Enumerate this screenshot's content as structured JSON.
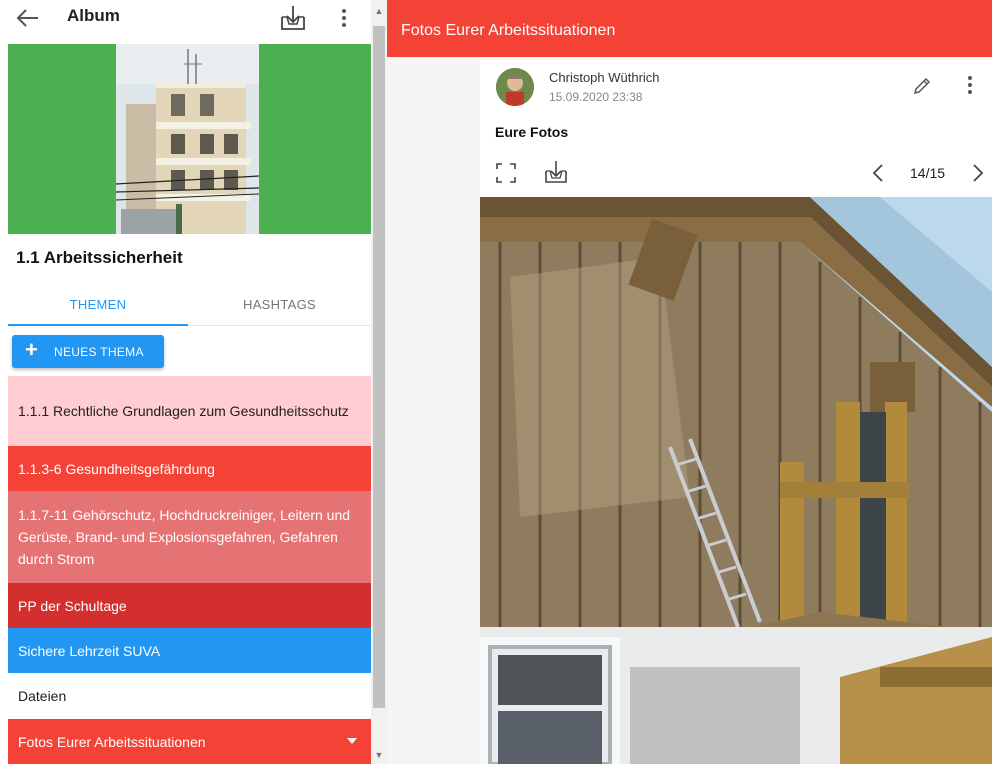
{
  "left": {
    "title": "Album",
    "section_title": "1.1 Arbeitssicherheit",
    "tabs": [
      {
        "label": "THEMEN",
        "active": true
      },
      {
        "label": "HASHTAGS",
        "active": false
      }
    ],
    "new_topic_label": "NEUES THEMA",
    "topics": [
      {
        "label": "1.1.1 Rechtliche Grundlagen zum Gesundheitsschutz",
        "color": "#ffcdd2"
      },
      {
        "label": "1.1.3-6 Gesundheitsgefährdung",
        "color": "#f44336"
      },
      {
        "label": "1.1.7-11 Gehörschutz, Hochdruckreiniger, Leitern und Gerüste, Brand- und Explosionsgefahren, Gefahren durch Strom",
        "color": "#e57373"
      },
      {
        "label": "PP der Schultage",
        "color": "#d32f2f"
      },
      {
        "label": "Sichere Lehrzeit SUVA",
        "color": "#2196f3"
      },
      {
        "label": "Dateien",
        "color": "#ffffff"
      },
      {
        "label": "Fotos Eurer Arbeitssituationen",
        "color": "#f44336"
      }
    ],
    "icons": {
      "back": "arrow-left-icon",
      "download": "download-icon",
      "more": "more-vertical-icon",
      "add": "plus-icon",
      "expand": "caret-down-icon"
    }
  },
  "right": {
    "header_title": "Fotos Eurer Arbeitssituationen",
    "post": {
      "author": "Christoph Wüthrich",
      "date": "15.09.2020 23:38",
      "title": "Eure Fotos",
      "counter": "14/15"
    },
    "icons": {
      "edit": "pencil-icon",
      "more": "more-vertical-icon",
      "fullscreen": "fullscreen-icon",
      "download": "download-icon",
      "prev": "chevron-left-icon",
      "next": "chevron-right-icon"
    }
  },
  "colors": {
    "accent_blue": "#2196f3",
    "header_red": "#f44336",
    "cover_green": "#4caf50"
  }
}
